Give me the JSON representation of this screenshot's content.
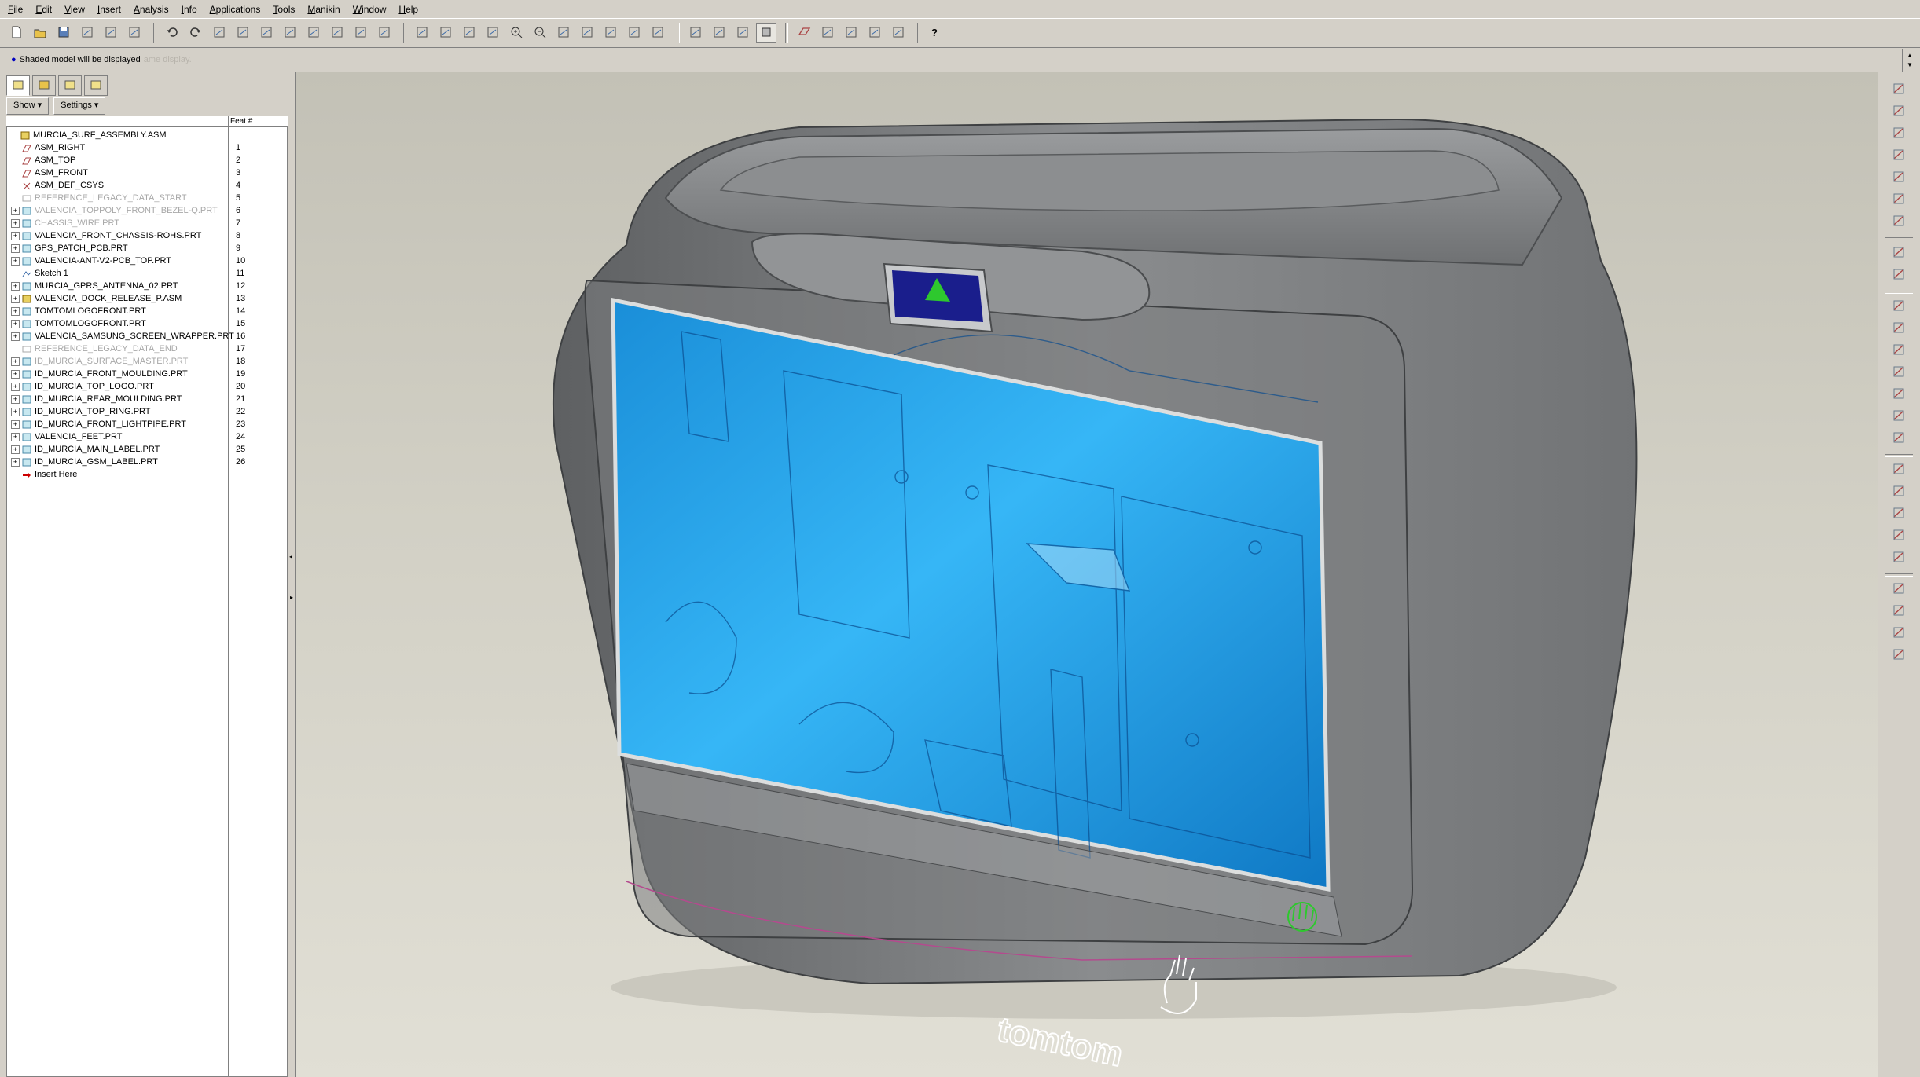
{
  "menu": [
    "File",
    "Edit",
    "View",
    "Insert",
    "Analysis",
    "Info",
    "Applications",
    "Tools",
    "Manikin",
    "Window",
    "Help"
  ],
  "toolbar_icons": [
    "new-file-icon",
    "open-file-icon",
    "save-icon",
    "print-icon",
    "print-preview-icon",
    "email-icon",
    "sep",
    "undo-icon",
    "redo-icon",
    "cut-icon",
    "copy-icon",
    "paste-icon",
    "paste-special-icon",
    "regenerate-icon",
    "regen-manager-icon",
    "find-icon",
    "select-box-icon",
    "sep",
    "repaint-icon",
    "spin-center-icon",
    "orient-mode-icon",
    "pan-icon",
    "zoom-in-icon",
    "zoom-out-icon",
    "refit-icon",
    "reorient-icon",
    "saved-views-icon",
    "layers-icon",
    "view-manager-icon",
    "sep",
    "wireframe-icon",
    "hidden-line-icon",
    "no-hidden-icon",
    "shading-icon",
    "sep",
    "datum-planes-icon",
    "datum-axes-icon",
    "datum-points-icon",
    "csys-icon",
    "annotation-icon",
    "sep",
    "context-help-icon"
  ],
  "message": {
    "text": "Shaded model will be displayed",
    "ghost": "ame display."
  },
  "nav_tabs": [
    "model-tree-tab",
    "folder-browser-tab",
    "favorites-tab",
    "connections-tab"
  ],
  "tree_buttons": {
    "show": "Show",
    "settings": "Settings"
  },
  "tree_header": {
    "feat_col": "Feat #"
  },
  "tree": [
    {
      "name": "MURCIA_SURF_ASSEMBLY.ASM",
      "feat": "",
      "icon": "asm",
      "level": 0,
      "expand": false,
      "suppressed": false
    },
    {
      "name": "ASM_RIGHT",
      "feat": "1",
      "icon": "plane",
      "level": 1,
      "expand": false,
      "suppressed": false
    },
    {
      "name": "ASM_TOP",
      "feat": "2",
      "icon": "plane",
      "level": 1,
      "expand": false,
      "suppressed": false
    },
    {
      "name": "ASM_FRONT",
      "feat": "3",
      "icon": "plane",
      "level": 1,
      "expand": false,
      "suppressed": false
    },
    {
      "name": "ASM_DEF_CSYS",
      "feat": "4",
      "icon": "csys",
      "level": 1,
      "expand": false,
      "suppressed": false
    },
    {
      "name": "REFERENCE_LEGACY_DATA_START",
      "feat": "5",
      "icon": "ref",
      "level": 1,
      "expand": false,
      "suppressed": true
    },
    {
      "name": "VALENCIA_TOPPOLY_FRONT_BEZEL-Q.PRT",
      "feat": "6",
      "icon": "part",
      "level": 1,
      "expand": true,
      "suppressed": true
    },
    {
      "name": "CHASSIS_WIRE.PRT",
      "feat": "7",
      "icon": "part",
      "level": 1,
      "expand": true,
      "suppressed": true
    },
    {
      "name": "VALENCIA_FRONT_CHASSIS-ROHS.PRT",
      "feat": "8",
      "icon": "part",
      "level": 1,
      "expand": true,
      "suppressed": false
    },
    {
      "name": "GPS_PATCH_PCB.PRT",
      "feat": "9",
      "icon": "part",
      "level": 1,
      "expand": true,
      "suppressed": false
    },
    {
      "name": "VALENCIA-ANT-V2-PCB_TOP.PRT",
      "feat": "10",
      "icon": "part",
      "level": 1,
      "expand": true,
      "suppressed": false
    },
    {
      "name": "Sketch 1",
      "feat": "11",
      "icon": "sketch",
      "level": 1,
      "expand": false,
      "suppressed": false
    },
    {
      "name": "MURCIA_GPRS_ANTENNA_02.PRT",
      "feat": "12",
      "icon": "part",
      "level": 1,
      "expand": true,
      "suppressed": false
    },
    {
      "name": "VALENCIA_DOCK_RELEASE_P.ASM",
      "feat": "13",
      "icon": "asm",
      "level": 1,
      "expand": true,
      "suppressed": false
    },
    {
      "name": "TOMTOMLOGOFRONT.PRT",
      "feat": "14",
      "icon": "part",
      "level": 1,
      "expand": true,
      "suppressed": false
    },
    {
      "name": "TOMTOMLOGOFRONT.PRT",
      "feat": "15",
      "icon": "part",
      "level": 1,
      "expand": true,
      "suppressed": false
    },
    {
      "name": "VALENCIA_SAMSUNG_SCREEN_WRAPPER.PRT",
      "feat": "16",
      "icon": "part",
      "level": 1,
      "expand": true,
      "suppressed": false
    },
    {
      "name": "REFERENCE_LEGACY_DATA_END",
      "feat": "17",
      "icon": "ref",
      "level": 1,
      "expand": false,
      "suppressed": true
    },
    {
      "name": "ID_MURCIA_SURFACE_MASTER.PRT",
      "feat": "18",
      "icon": "part",
      "level": 1,
      "expand": true,
      "suppressed": true
    },
    {
      "name": "ID_MURCIA_FRONT_MOULDING.PRT",
      "feat": "19",
      "icon": "part",
      "level": 1,
      "expand": true,
      "suppressed": false
    },
    {
      "name": "ID_MURCIA_TOP_LOGO.PRT",
      "feat": "20",
      "icon": "part",
      "level": 1,
      "expand": true,
      "suppressed": false
    },
    {
      "name": "ID_MURCIA_REAR_MOULDING.PRT",
      "feat": "21",
      "icon": "part",
      "level": 1,
      "expand": true,
      "suppressed": false
    },
    {
      "name": "ID_MURCIA_TOP_RING.PRT",
      "feat": "22",
      "icon": "part",
      "level": 1,
      "expand": true,
      "suppressed": false
    },
    {
      "name": "ID_MURCIA_FRONT_LIGHTPIPE.PRT",
      "feat": "23",
      "icon": "part",
      "level": 1,
      "expand": true,
      "suppressed": false
    },
    {
      "name": "VALENCIA_FEET.PRT",
      "feat": "24",
      "icon": "part",
      "level": 1,
      "expand": true,
      "suppressed": false
    },
    {
      "name": "ID_MURCIA_MAIN_LABEL.PRT",
      "feat": "25",
      "icon": "part",
      "level": 1,
      "expand": true,
      "suppressed": false
    },
    {
      "name": "ID_MURCIA_GSM_LABEL.PRT",
      "feat": "26",
      "icon": "part",
      "level": 1,
      "expand": true,
      "suppressed": false
    },
    {
      "name": "Insert Here",
      "feat": "",
      "icon": "insert",
      "level": 1,
      "expand": false,
      "suppressed": false
    }
  ],
  "model": {
    "logo_text": "tomtom",
    "housing_color": "#86888a",
    "screen_color": "#2aa8f0",
    "accent_color": "#2ec82e"
  },
  "right_toolbar_icons": [
    "datum-curve-sketch-icon",
    "datum-plane-icon",
    "datum-axis-icon",
    "datum-curve-icon",
    "datum-point-icon",
    "csys-create-icon",
    "analysis-icon",
    "sep",
    "style-icon",
    "boundary-blend-icon",
    "sep",
    "extrude-icon",
    "revolve-icon",
    "variable-sweep-icon",
    "blend-icon",
    "fill-icon",
    "sweep-icon",
    "helical-icon",
    "sep",
    "round-icon",
    "draft-icon",
    "shell-icon",
    "rib-icon",
    "hole-icon",
    "sep",
    "mirror-icon",
    "merge-icon",
    "trim-icon",
    "pattern-icon"
  ]
}
